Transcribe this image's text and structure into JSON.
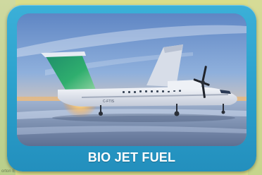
{
  "card": {
    "caption": "BIO JET FUEL",
    "accent_color": "#2a9fcb"
  },
  "photo": {
    "aircraft_registration": "C-FTIS",
    "subject": "airplane-image"
  },
  "corner": {
    "text": "orton E"
  }
}
